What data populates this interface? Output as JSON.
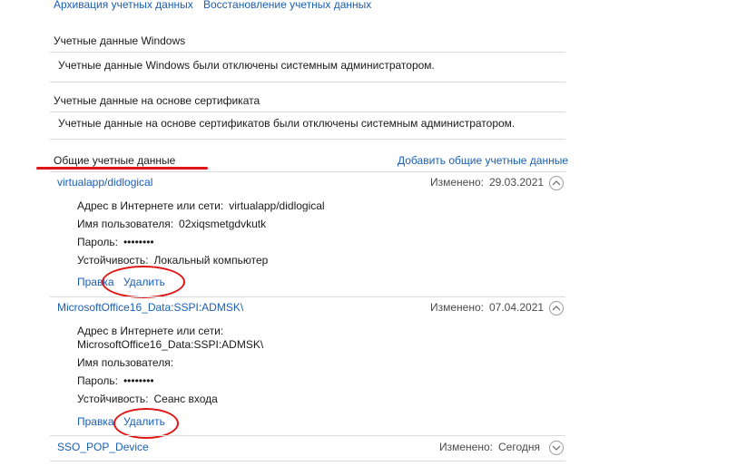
{
  "top_links": {
    "backup": "Архивация учетных данных",
    "restore": "Восстановление учетных данных"
  },
  "windows_section": {
    "title": "Учетные данные Windows",
    "message": "Учетные данные Windows были отключены системным администратором."
  },
  "cert_section": {
    "title": "Учетные данные на основе сертификата",
    "message": "Учетные данные на основе сертификатов были отключены системным администратором."
  },
  "generic_section": {
    "title": "Общие учетные данные",
    "add_link": "Добавить общие учетные данные"
  },
  "credentials": [
    {
      "name": "virtualapp/didlogical",
      "changed_label": "Изменено:",
      "changed_value": "29.03.2021",
      "address_label": "Адрес в Интернете или сети:",
      "address_value": "virtualapp/didlogical",
      "user_label": "Имя пользователя:",
      "user_value": "02xiqsmetgdvkutk",
      "password_label": "Пароль:",
      "password_value": "••••••••",
      "persistence_label": "Устойчивость:",
      "persistence_value": "Локальный компьютер",
      "edit": "Правка",
      "delete": "Удалить"
    },
    {
      "name": "MicrosoftOffice16_Data:SSPI:ADMSK\\",
      "changed_label": "Изменено:",
      "changed_value": "07.04.2021",
      "address_label": "Адрес в Интернете или сети:",
      "address_value": "MicrosoftOffice16_Data:SSPI:ADMSK\\",
      "user_label": "Имя пользователя:",
      "user_value": "",
      "password_label": "Пароль:",
      "password_value": "••••••••",
      "persistence_label": "Устойчивость:",
      "persistence_value": "Сеанс входа",
      "edit": "Правка",
      "delete": "Удалить"
    },
    {
      "name": "SSO_POP_Device",
      "changed_label": "Изменено:",
      "changed_value": "Сегодня"
    }
  ],
  "colors": {
    "link": "#1a5fb4",
    "annotation": "#e01515",
    "divider": "#dcdcdc"
  }
}
